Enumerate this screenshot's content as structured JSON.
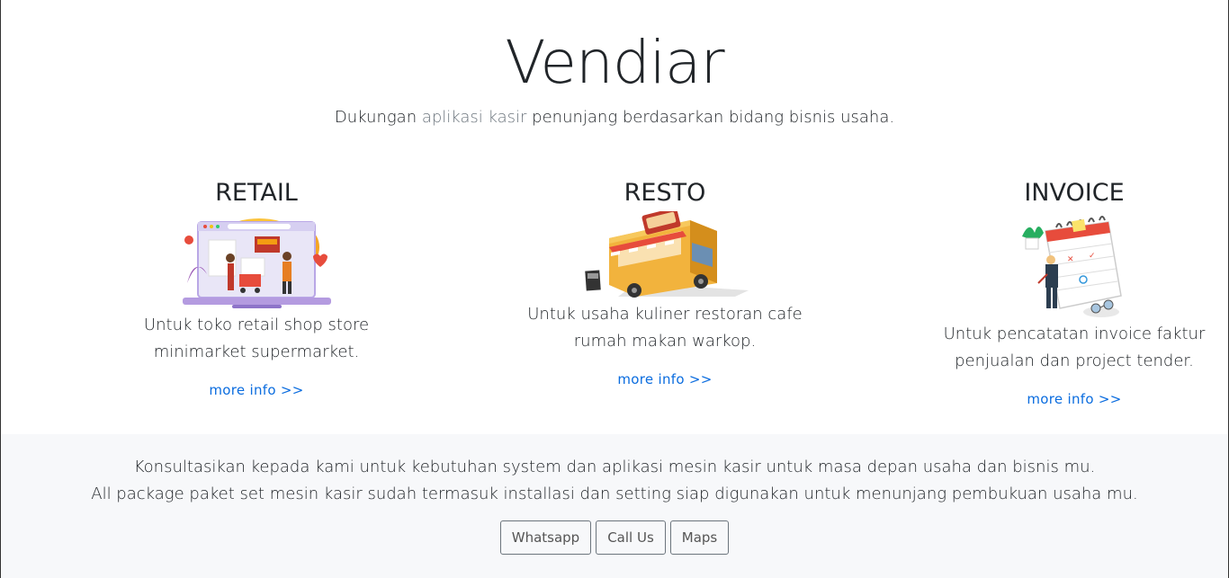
{
  "hero": {
    "title": "Vendiar",
    "tagline_prefix": "Dukungan ",
    "tagline_highlight": "aplikasi kasir",
    "tagline_suffix": " penunjang berdasarkan bidang bisnis usaha."
  },
  "features": [
    {
      "title": "RETAIL",
      "line1": "Untuk toko retail shop store",
      "line2": "minimarket supermarket.",
      "link": "more info >>",
      "illustration": "retail-shopping-illustration"
    },
    {
      "title": "RESTO",
      "line1": "Untuk usaha kuliner restoran cafe",
      "line2": "rumah makan warkop.",
      "link": "more info >>",
      "illustration": "food-truck-illustration"
    },
    {
      "title": "INVOICE",
      "line1": "Untuk pencatatan invoice faktur",
      "line2": "penjualan dan project tender.",
      "link": "more info >>",
      "illustration": "calendar-planning-illustration"
    }
  ],
  "footer": {
    "line1": "Konsultasikan kepada kami untuk kebutuhan system dan aplikasi mesin kasir untuk masa depan usaha dan bisnis mu.",
    "line2": "All package paket set mesin kasir sudah termasuk installasi dan setting siap digunakan untuk menunjang pembukuan usaha mu.",
    "buttons": [
      "Whatsapp",
      "Call Us",
      "Maps"
    ]
  }
}
